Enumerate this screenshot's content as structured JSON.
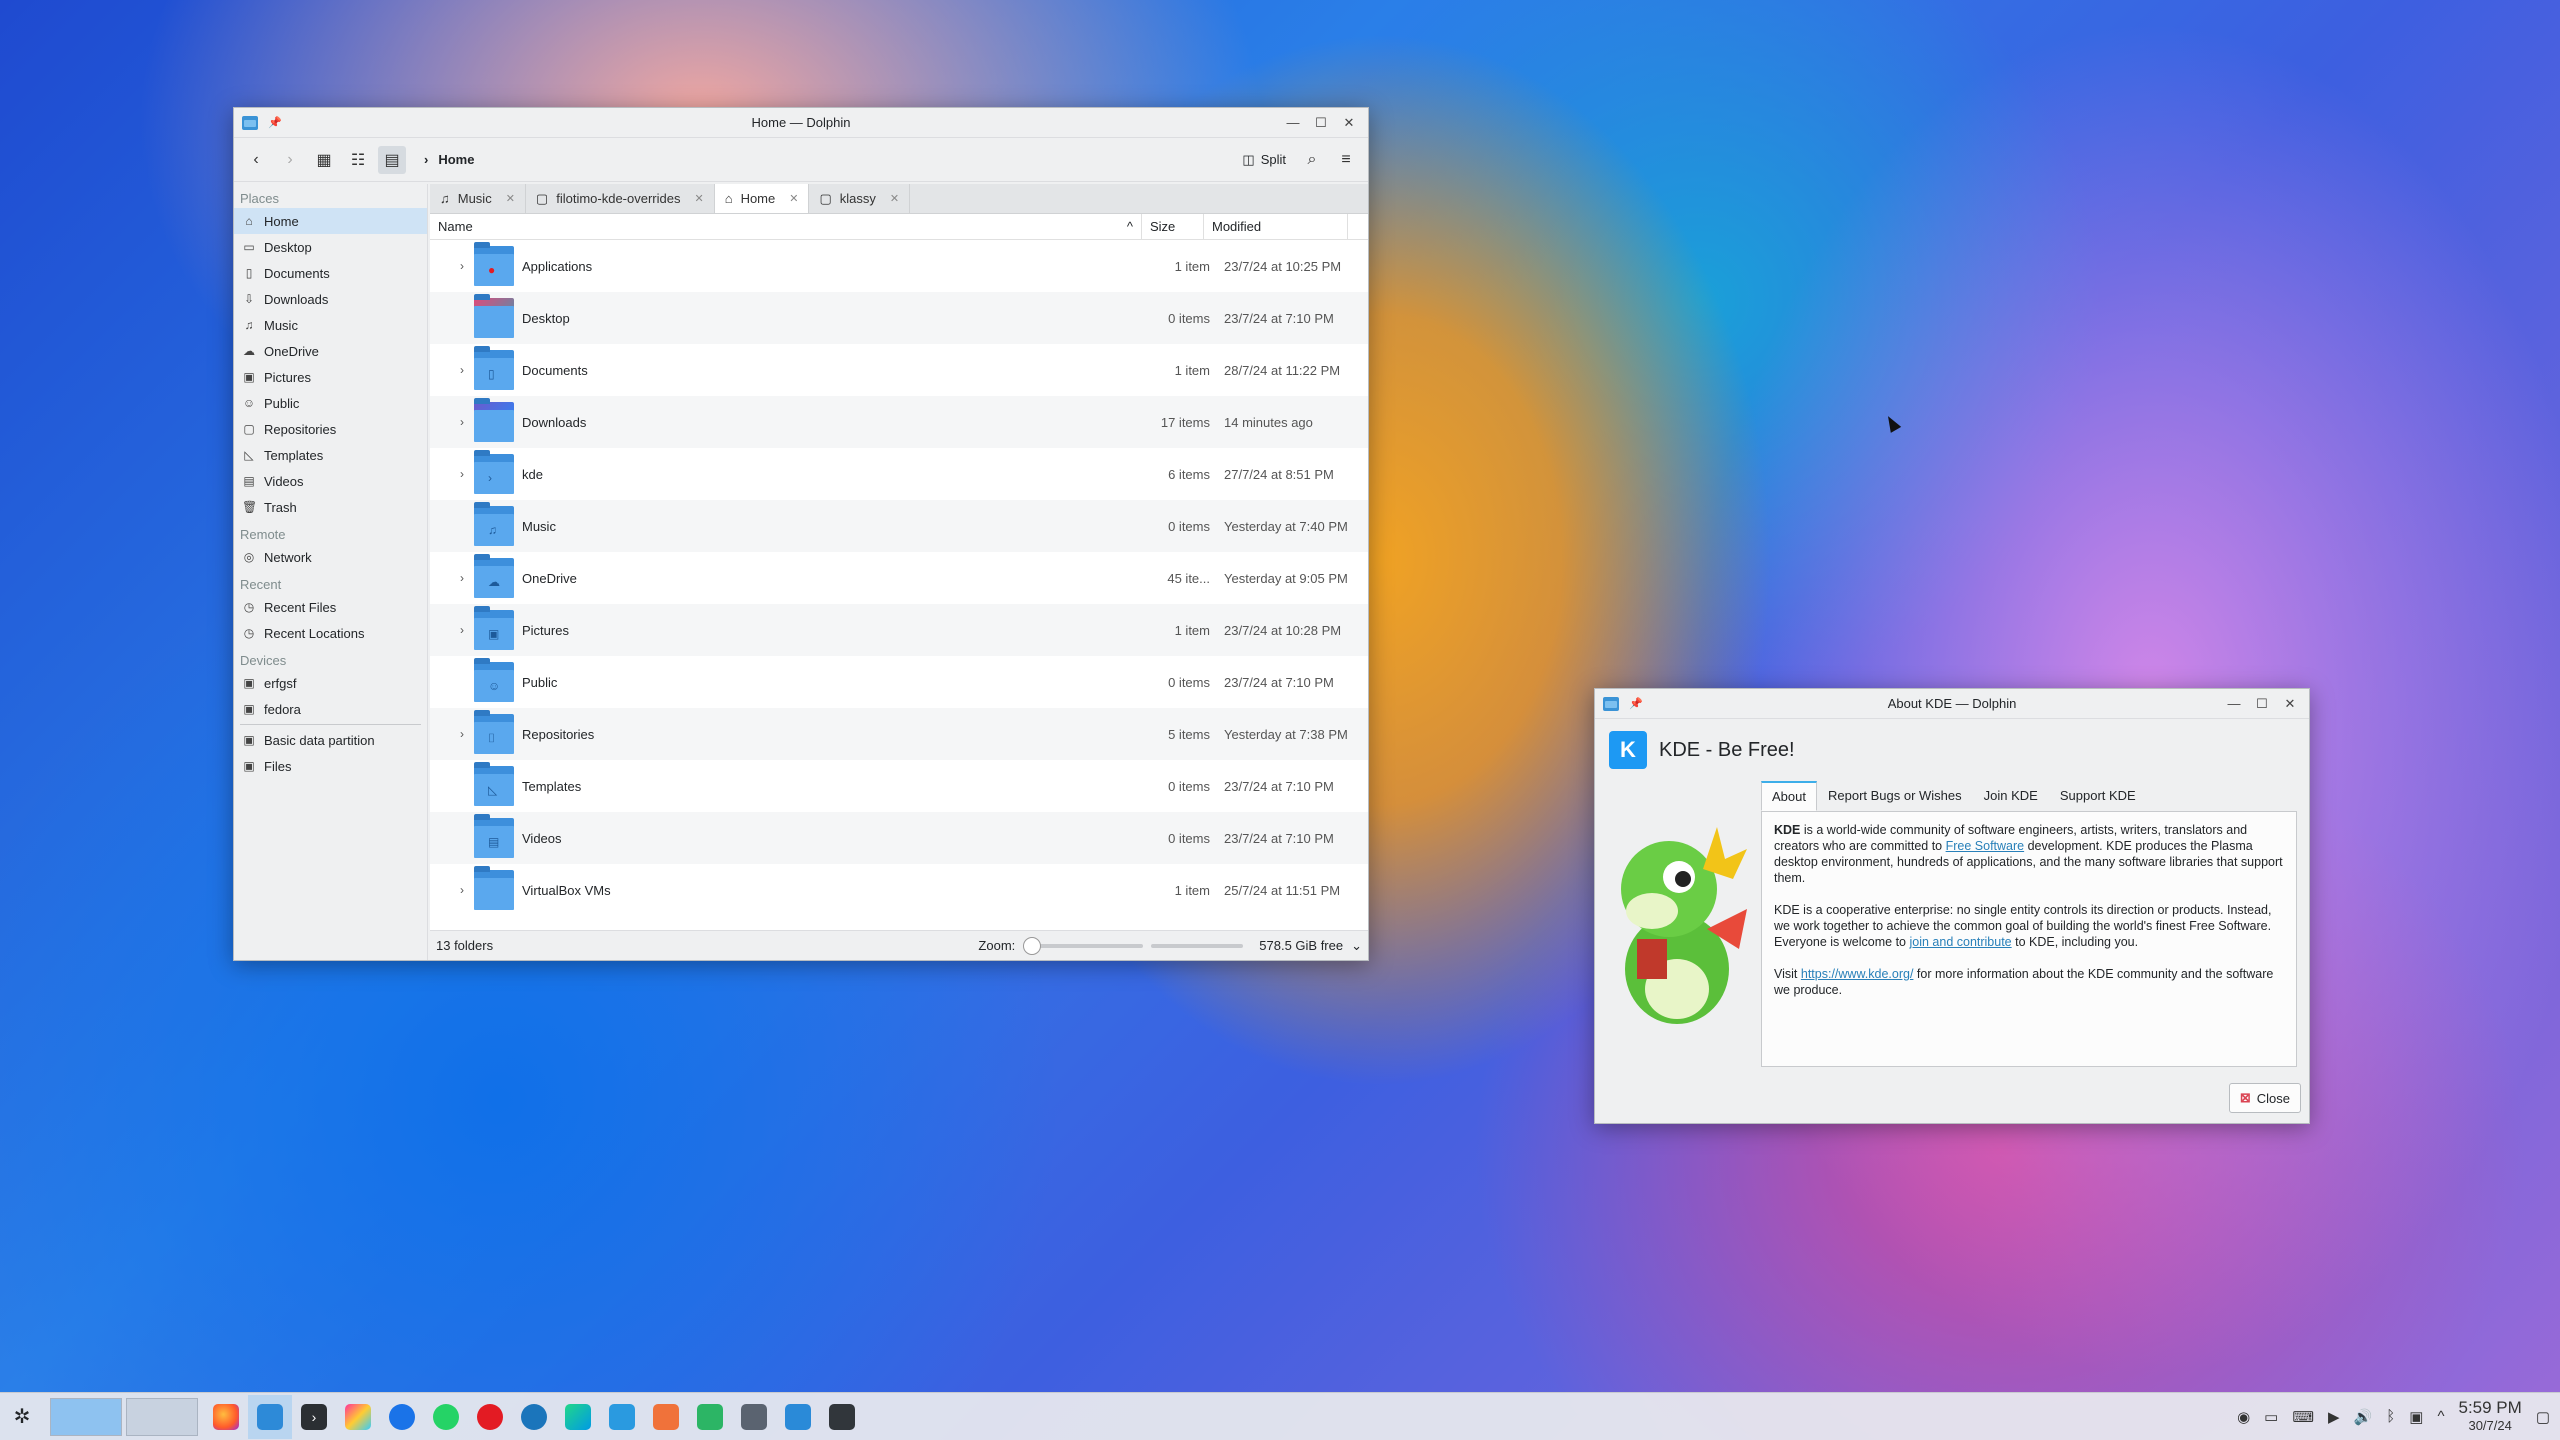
{
  "dolphin": {
    "title": "Home — Dolphin",
    "crumb": "Home",
    "split_label": "Split",
    "places": [
      {
        "section": "Places",
        "items": [
          {
            "label": "Home",
            "icon": "home-icon",
            "sel": true
          },
          {
            "label": "Desktop",
            "icon": "desktop-icon"
          },
          {
            "label": "Documents",
            "icon": "documents-icon"
          },
          {
            "label": "Downloads",
            "icon": "downloads-icon"
          },
          {
            "label": "Music",
            "icon": "music-icon"
          },
          {
            "label": "OneDrive",
            "icon": "cloud-icon"
          },
          {
            "label": "Pictures",
            "icon": "pictures-icon"
          },
          {
            "label": "Public",
            "icon": "public-icon"
          },
          {
            "label": "Repositories",
            "icon": "folder-icon"
          },
          {
            "label": "Templates",
            "icon": "templates-icon"
          },
          {
            "label": "Videos",
            "icon": "videos-icon"
          },
          {
            "label": "Trash",
            "icon": "trash-icon"
          }
        ]
      },
      {
        "section": "Remote",
        "items": [
          {
            "label": "Network",
            "icon": "network-icon"
          }
        ]
      },
      {
        "section": "Recent",
        "items": [
          {
            "label": "Recent Files",
            "icon": "recent-files-icon"
          },
          {
            "label": "Recent Locations",
            "icon": "recent-locations-icon"
          }
        ]
      },
      {
        "section": "Devices",
        "items": [
          {
            "label": "erfgsf",
            "icon": "drive-icon"
          },
          {
            "label": "fedora",
            "icon": "drive-icon"
          },
          {
            "label": "Basic data partition",
            "icon": "drive-icon"
          },
          {
            "label": "Files",
            "icon": "drive-icon"
          }
        ]
      }
    ],
    "tabs": [
      {
        "label": "Music",
        "icon": "music-icon"
      },
      {
        "label": "filotimo-kde-overrides",
        "icon": "folder-icon"
      },
      {
        "label": "Home",
        "icon": "home-icon",
        "active": true
      },
      {
        "label": "klassy",
        "icon": "folder-icon"
      }
    ],
    "columns": {
      "name": "Name",
      "size": "Size",
      "modified": "Modified"
    },
    "files": [
      {
        "name": "Applications",
        "size": "1 item",
        "modified": "23/7/24 at 10:25 PM",
        "exp": true,
        "glyph": "▶"
      },
      {
        "name": "Desktop",
        "size": "0 items",
        "modified": "23/7/24 at 7:10 PM",
        "exp": false,
        "glyph": ""
      },
      {
        "name": "Documents",
        "size": "1 item",
        "modified": "28/7/24 at 11:22 PM",
        "exp": true,
        "glyph": "▯"
      },
      {
        "name": "Downloads",
        "size": "17 items",
        "modified": "14 minutes ago",
        "exp": true,
        "glyph": "⬇"
      },
      {
        "name": "kde",
        "size": "6 items",
        "modified": "27/7/24 at 8:51 PM",
        "exp": true,
        "glyph": "›"
      },
      {
        "name": "Music",
        "size": "0 items",
        "modified": "Yesterday at 7:40 PM",
        "exp": false,
        "glyph": "♫"
      },
      {
        "name": "OneDrive",
        "size": "45 ite...",
        "modified": "Yesterday at 9:05 PM",
        "exp": true,
        "glyph": "☁"
      },
      {
        "name": "Pictures",
        "size": "1 item",
        "modified": "23/7/24 at 10:28 PM",
        "exp": true,
        "glyph": "▣"
      },
      {
        "name": "Public",
        "size": "0 items",
        "modified": "23/7/24 at 7:10 PM",
        "exp": false,
        "glyph": "☺"
      },
      {
        "name": "Repositories",
        "size": "5 items",
        "modified": "Yesterday at 7:38 PM",
        "exp": true,
        "glyph": "⌷"
      },
      {
        "name": "Templates",
        "size": "0 items",
        "modified": "23/7/24 at 7:10 PM",
        "exp": false,
        "glyph": "◺"
      },
      {
        "name": "Videos",
        "size": "0 items",
        "modified": "23/7/24 at 7:10 PM",
        "exp": false,
        "glyph": "▤"
      },
      {
        "name": "VirtualBox VMs",
        "size": "1 item",
        "modified": "25/7/24 at 11:51 PM",
        "exp": true,
        "glyph": ""
      }
    ],
    "status": {
      "count": "13 folders",
      "zoom_label": "Zoom:",
      "free": "578.5 GiB free"
    }
  },
  "about": {
    "title": "About KDE — Dolphin",
    "heading": "KDE - Be Free!",
    "tabs": [
      "About",
      "Report Bugs or Wishes",
      "Join KDE",
      "Support KDE"
    ],
    "p1_strong": "KDE",
    "p1_a": " is a world-wide community of software engineers, artists, writers, translators and creators who are committed to ",
    "p1_link": "Free Software",
    "p1_b": " development. KDE produces the Plasma desktop environment, hundreds of applications, and the many software libraries that support them.",
    "p2_a": "KDE is a cooperative enterprise: no single entity controls its direction or products. Instead, we work together to achieve the common goal of building the world's finest Free Software. Everyone is welcome to ",
    "p2_link": "join and contribute",
    "p2_b": " to KDE, including you.",
    "p3_a": "Visit ",
    "p3_link": "https://www.kde.org/",
    "p3_b": " for more information about the KDE community and the software we produce.",
    "close_label": "Close"
  },
  "taskbar": {
    "clock_time": "5:59 PM",
    "clock_date": "30/7/24"
  }
}
